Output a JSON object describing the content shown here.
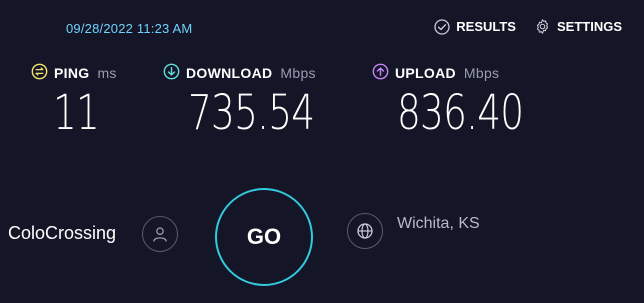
{
  "timestamp": "09/28/2022 11:23 AM",
  "nav": {
    "results_label": "RESULTS",
    "settings_label": "SETTINGS"
  },
  "metrics": {
    "ping": {
      "label": "PING",
      "unit": "ms",
      "value": "11",
      "icon": "ping-icon",
      "color": "#f5e46b"
    },
    "download": {
      "label": "DOWNLOAD",
      "unit": "Mbps",
      "value": "735.54",
      "icon": "download-arrow-icon",
      "color": "#5fe0dc"
    },
    "upload": {
      "label": "UPLOAD",
      "unit": "Mbps",
      "value": "836.40",
      "icon": "upload-arrow-icon",
      "color": "#c486f5"
    }
  },
  "server": {
    "isp_name": "ColoCrossing",
    "location": "Wichita, KS"
  },
  "go_label": "GO",
  "colors": {
    "background": "#141526",
    "timestamp": "#6fd3ff",
    "go_ring": "#34c9dd"
  }
}
